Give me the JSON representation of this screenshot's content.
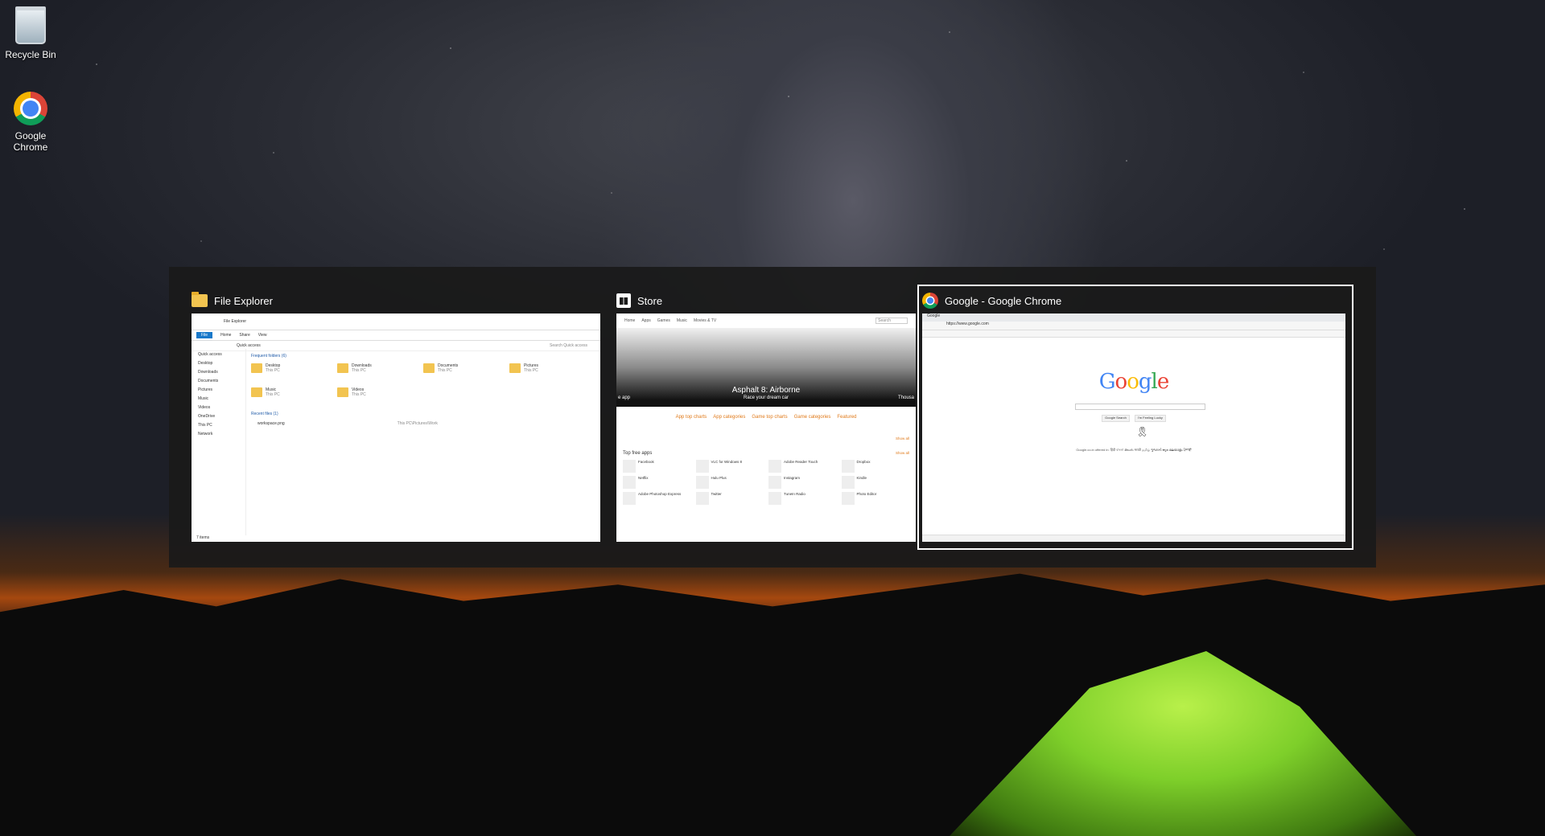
{
  "desktop": {
    "icons": [
      {
        "label": "Recycle Bin",
        "icon": "recycle-bin-icon"
      },
      {
        "label": "Google Chrome",
        "icon": "chrome-icon"
      }
    ]
  },
  "switcher": {
    "windows": [
      {
        "title": "File Explorer",
        "icon": "folder-icon",
        "thumb": {
          "window_title": "File Explorer",
          "ribbon": [
            "File",
            "Home",
            "Share",
            "View"
          ],
          "address": "Quick access",
          "search_placeholder": "Search Quick access",
          "sidebar": [
            "Quick access",
            "Desktop",
            "Downloads",
            "Documents",
            "Pictures",
            "Music",
            "Videos",
            "OneDrive",
            "This PC",
            "Network"
          ],
          "frequent_header": "Frequent folders (6)",
          "folders": [
            {
              "name": "Desktop",
              "sub": "This PC"
            },
            {
              "name": "Downloads",
              "sub": "This PC"
            },
            {
              "name": "Documents",
              "sub": "This PC"
            },
            {
              "name": "Pictures",
              "sub": "This PC"
            },
            {
              "name": "Music",
              "sub": "This PC"
            },
            {
              "name": "Videos",
              "sub": "This PC"
            }
          ],
          "recent_header": "Recent files (1)",
          "recent_file": "workspace.png",
          "recent_path": "This PC\\Pictures\\Work",
          "status": "7 items"
        }
      },
      {
        "title": "Store",
        "icon": "store-icon",
        "thumb": {
          "nav": [
            "Home",
            "Apps",
            "Games",
            "Music",
            "Movies & TV"
          ],
          "search": "Search",
          "hero_title": "Asphalt 8: Airborne",
          "hero_sub": "Race your dream car",
          "hero_left": "e app",
          "hero_right": "Thousa",
          "links": [
            "App top charts",
            "App categories",
            "Game top charts",
            "Game categories",
            "Featured"
          ],
          "show_all": "Show all",
          "section": "Top free apps",
          "apps": [
            "Facebook",
            "VLC for Windows 8",
            "Adobe Reader Touch",
            "Dropbox",
            "Netflix",
            "Hulu Plus",
            "Instagram",
            "Kindle",
            "Adobe Photoshop Express",
            "Twitter",
            "TuneIn Radio",
            "Photo Editor"
          ]
        }
      },
      {
        "title": "Google - Google Chrome",
        "icon": "chrome-icon",
        "selected": true,
        "thumb": {
          "tab": "Google",
          "url": "https://www.google.com",
          "logo": "Google",
          "buttons": [
            "Google Search",
            "I'm Feeling Lucky"
          ],
          "languages": "Google.co.in offered in: हिंदी বাংলা తెలుగు मराठी தமிழ் ગુજરાતી ಕನ್ನಡ മലയാളം ਪੰਜਾਬੀ"
        }
      }
    ]
  },
  "colors": {
    "switcher_bg": "#1a1a1a",
    "selection_border": "#ffffff",
    "store_link": "#e07a1a",
    "fe_file_tab": "#1979ca"
  }
}
